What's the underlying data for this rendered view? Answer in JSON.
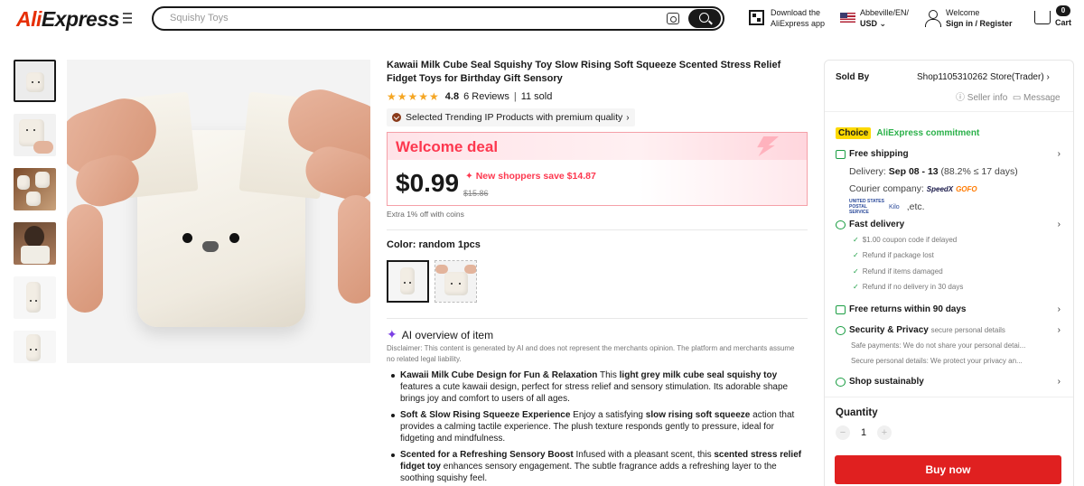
{
  "header": {
    "logo_primary": "Ali",
    "logo_secondary": "Express",
    "search_placeholder": "Squishy Toys",
    "download_line1": "Download the",
    "download_line2": "AliExpress app",
    "locale_line1": "Abbeville/EN/",
    "locale_line2": "USD",
    "welcome_line1": "Welcome",
    "welcome_line2": "Sign in / Register",
    "cart_count": "0",
    "cart_label": "Cart"
  },
  "gallery": {
    "thumbnail_count": 6,
    "active_index": 0
  },
  "product": {
    "title": "Kawaii Milk Cube Seal Squishy Toy Slow Rising Soft Squeeze Scented Stress Relief Fidget Toys for Birthday Gift Sensory",
    "stars": "★★★★★",
    "rating": "4.8",
    "reviews": "6 Reviews",
    "separator": "|",
    "sold": "11 sold",
    "trending": "Selected Trending IP Products with premium quality",
    "deal_title": "Welcome deal",
    "price": "$0.99",
    "save_text": "New shoppers save $14.87",
    "original_price": "$15.86",
    "extra_coins": "Extra 1% off with coins",
    "color_label": "Color: random 1pcs"
  },
  "ai_overview": {
    "heading": "AI overview of item",
    "disclaimer": "Disclaimer: This content is generated by AI and does not represent the merchants opinion. The platform and merchants assume no related legal liability.",
    "bullets": [
      {
        "title": "Kawaii Milk Cube Design for Fun & Relaxation",
        "pre": " This ",
        "strong": "light grey milk cube seal squishy toy",
        "post": " features a cute kawaii design, perfect for stress relief and sensory stimulation. Its adorable shape brings joy and comfort to users of all ages."
      },
      {
        "title": "Soft & Slow Rising Squeeze Experience",
        "pre": " Enjoy a satisfying ",
        "strong": "slow rising soft squeeze",
        "post": " action that provides a calming tactile experience. The plush texture responds gently to pressure, ideal for fidgeting and mindfulness."
      },
      {
        "title": "Scented for a Refreshing Sensory Boost",
        "pre": " Infused with a pleasant scent, this ",
        "strong": "scented stress relief fidget toy",
        "post": " enhances sensory engagement. The subtle fragrance adds a refreshing layer to the soothing squishy feel."
      }
    ]
  },
  "seller": {
    "sold_by_label": "Sold By",
    "store_name": "Shop1105310262 Store(Trader)",
    "seller_info": "Seller info",
    "message": "Message"
  },
  "commitment": {
    "choice_badge": "Choice",
    "commitment_label": "AliExpress commitment",
    "free_shipping": "Free shipping",
    "delivery_prefix": "Delivery: ",
    "delivery_dates": "Sep 08 - 13",
    "delivery_suffix": " (88.2% ≤ 17 days)",
    "courier_label": "Courier company:",
    "courier_1": "SpeedX",
    "courier_2": "GOFO",
    "courier_3": "UNITED STATES POSTAL SERVICE",
    "courier_4": "Kilo",
    "courier_etc": ",etc.",
    "fast_delivery": "Fast delivery",
    "fast_items": [
      "$1.00 coupon code if delayed",
      "Refund if package lost",
      "Refund if items damaged",
      "Refund if no delivery in 30 days"
    ],
    "free_returns": "Free returns within 90 days",
    "security_title": "Security & Privacy",
    "security_sub": "secure personal details",
    "security_lines": [
      "Safe payments: We do not share your personal detai...",
      "Secure personal details: We protect your privacy an..."
    ],
    "shop_sustainably": "Shop sustainably"
  },
  "purchase": {
    "quantity_label": "Quantity",
    "quantity_value": "1",
    "minus": "−",
    "plus": "+",
    "buy_now": "Buy now"
  },
  "colors": {
    "brand_red": "#e62e04",
    "deal_red": "#fd384f",
    "buy_red": "#e02020",
    "star": "#f5a623",
    "green": "#1c9e44",
    "choice_yellow": "#fdd900"
  }
}
